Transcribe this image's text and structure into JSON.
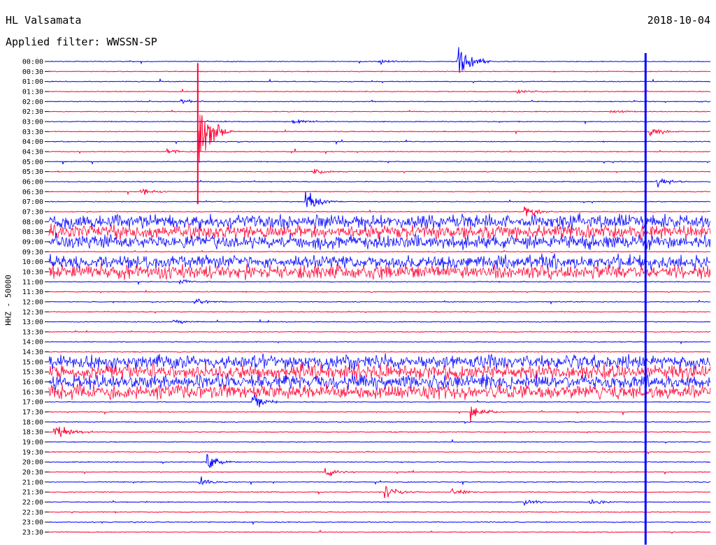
{
  "header": {
    "station": "HL Valsamata",
    "filter": "Applied filter: WWSSN-SP",
    "date": "2018-10-04"
  },
  "colors": {
    "even": "#0000ff",
    "odd": "#ff0033"
  },
  "chart_data": {
    "type": "line",
    "ylabel": "HHZ - 50000",
    "rows": [
      "00:00",
      "00:30",
      "01:00",
      "01:30",
      "02:00",
      "02:30",
      "03:00",
      "03:30",
      "04:00",
      "04:30",
      "05:00",
      "05:30",
      "06:00",
      "06:30",
      "07:00",
      "07:30",
      "08:00",
      "08:30",
      "09:00",
      "09:30",
      "10:00",
      "10:30",
      "11:00",
      "11:30",
      "12:00",
      "12:30",
      "13:00",
      "13:30",
      "14:00",
      "14:30",
      "15:00",
      "15:30",
      "16:00",
      "16:30",
      "17:00",
      "17:30",
      "18:00",
      "18:30",
      "19:00",
      "19:30",
      "20:00",
      "20:30",
      "21:00",
      "21:30",
      "22:00",
      "22:30",
      "23:00",
      "23:30"
    ],
    "noisy_rows": [
      "08:00",
      "08:30",
      "09:00",
      "10:00",
      "10:30",
      "15:00",
      "15:30",
      "16:00",
      "16:30"
    ],
    "events": [
      {
        "row": "00:00",
        "t": 0.62,
        "amp": 50
      },
      {
        "row": "00:00",
        "t": 0.5,
        "amp": 4
      },
      {
        "row": "01:30",
        "t": 0.71,
        "amp": 4
      },
      {
        "row": "02:00",
        "t": 0.2,
        "amp": 5
      },
      {
        "row": "02:30",
        "t": 0.85,
        "amp": 5
      },
      {
        "row": "03:00",
        "t": 0.37,
        "amp": 5
      },
      {
        "row": "03:30",
        "t": 0.23,
        "amp": 90
      },
      {
        "row": "03:30",
        "t": 0.91,
        "amp": 12
      },
      {
        "row": "04:30",
        "t": 0.18,
        "amp": 5
      },
      {
        "row": "05:30",
        "t": 0.4,
        "amp": 8
      },
      {
        "row": "06:00",
        "t": 0.92,
        "amp": 14
      },
      {
        "row": "06:30",
        "t": 0.14,
        "amp": 8
      },
      {
        "row": "07:00",
        "t": 0.39,
        "amp": 30
      },
      {
        "row": "07:30",
        "t": 0.72,
        "amp": 16
      },
      {
        "row": "11:00",
        "t": 0.2,
        "amp": 6
      },
      {
        "row": "12:00",
        "t": 0.22,
        "amp": 8
      },
      {
        "row": "13:00",
        "t": 0.19,
        "amp": 7
      },
      {
        "row": "17:00",
        "t": 0.31,
        "amp": 16
      },
      {
        "row": "17:30",
        "t": 0.64,
        "amp": 18
      },
      {
        "row": "18:30",
        "t": 0.01,
        "amp": 20
      },
      {
        "row": "20:00",
        "t": 0.24,
        "amp": 16
      },
      {
        "row": "20:30",
        "t": 0.42,
        "amp": 10
      },
      {
        "row": "21:00",
        "t": 0.23,
        "amp": 8
      },
      {
        "row": "21:30",
        "t": 0.51,
        "amp": 16
      },
      {
        "row": "21:30",
        "t": 0.61,
        "amp": 10
      },
      {
        "row": "22:00",
        "t": 0.72,
        "amp": 6
      },
      {
        "row": "22:00",
        "t": 0.82,
        "amp": 6
      }
    ],
    "persistent_spikes": [
      {
        "t": 0.902,
        "from": "00:00",
        "to": "23:30"
      },
      {
        "t": 0.225,
        "from": "00:30",
        "to": "06:30"
      }
    ]
  }
}
